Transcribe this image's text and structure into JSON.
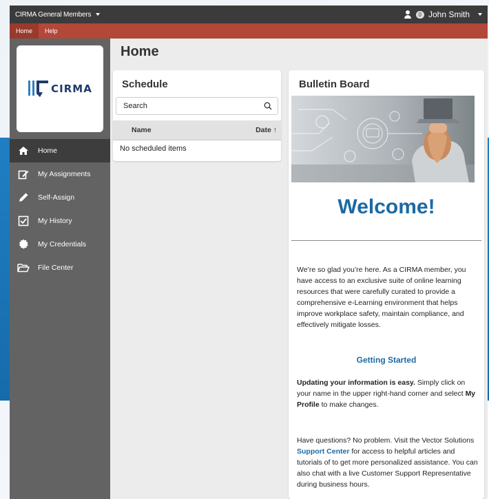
{
  "topbar": {
    "org": "CIRMA General Members",
    "badge": "0",
    "user": "John Smith"
  },
  "navbar": {
    "items": [
      "Home",
      "Help"
    ]
  },
  "sidebar": {
    "logo_text": "CIRMA",
    "items": [
      {
        "label": "Home",
        "icon": "home-icon"
      },
      {
        "label": "My Assignments",
        "icon": "edit-icon"
      },
      {
        "label": "Self-Assign",
        "icon": "pencil-icon"
      },
      {
        "label": "My History",
        "icon": "checkbox-icon"
      },
      {
        "label": "My Credentials",
        "icon": "badge-icon"
      },
      {
        "label": "File Center",
        "icon": "folder-open-icon"
      }
    ]
  },
  "main": {
    "page_title": "Home",
    "schedule": {
      "title": "Schedule",
      "search_placeholder": "Search",
      "col_name": "Name",
      "col_date": "Date ↑",
      "empty": "No scheduled items"
    },
    "bulletin": {
      "title": "Bulletin Board",
      "welcome": "Welcome!",
      "p1": "We’re so glad you’re here. As a CIRMA member, you have access to an exclusive suite of online learning resources that were carefully curated to provide a comprehensive e-Learning environment that helps improve workplace safety, maintain compliance, and effectively mitigate losses.",
      "getting_started": "Getting Started",
      "p2_bold": "Updating your information is easy.",
      "p2_a": " Simply click on your name in the upper right-hand corner and select ",
      "p2_bold2": "My Profile",
      "p2_b": " to make changes.",
      "p3_a": "Have questions? No problem. Visit the Vector Solutions ",
      "p3_link": "Support Center",
      "p3_b": " for access to helpful articles and tutorials of to get more personalized assistance. You can also chat with a live Customer Support Representative during business hours."
    }
  },
  "colors": {
    "topbar": "#3b3b3b",
    "navbar": "#b34738",
    "sidebar": "#636363",
    "accent": "#1b6aa3"
  }
}
